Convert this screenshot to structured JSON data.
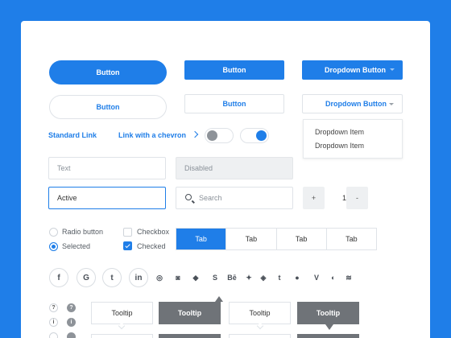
{
  "buttons": {
    "pill_fill": "Button",
    "pill_outline": "Button",
    "rect_fill": "Button",
    "rect_outline": "Button",
    "dropdown_fill": "Dropdown Button",
    "dropdown_outline": "Dropdown Button"
  },
  "dropdown_menu": {
    "items": [
      "Dropdown Item",
      "Dropdown Item"
    ]
  },
  "links": {
    "standard": "Standard Link",
    "chevron": "Link with a chevron"
  },
  "inputs": {
    "text_placeholder": "Text",
    "disabled_placeholder": "Disabled",
    "active_value": "Active",
    "search_placeholder": "Search"
  },
  "stepper": {
    "minus": "-",
    "value": "1",
    "plus": "+"
  },
  "radios": {
    "unselected": "Radio button",
    "selected": "Selected"
  },
  "checkboxes": {
    "unchecked": "Checkbox",
    "checked": "Checked"
  },
  "tabs": [
    "Tab",
    "Tab",
    "Tab",
    "Tab"
  ],
  "social": {
    "circle": [
      "f",
      "G",
      "t",
      "in"
    ],
    "glyph": [
      "◎",
      "◙",
      "◆",
      "S",
      "Bē",
      "✦",
      "◈",
      "t",
      "●",
      "V",
      "◐",
      "≋"
    ],
    "icon_names": [
      "facebook-icon",
      "google-icon",
      "twitter-icon",
      "linkedin-icon",
      "dribbble-icon",
      "instagram-icon",
      "dropbox-icon",
      "skype-icon",
      "behance-icon",
      "yelp-icon",
      "codepen-icon",
      "tumblr-icon",
      "github-icon",
      "vimeo-icon",
      "vine-icon",
      "rss-icon"
    ]
  },
  "tooltips": {
    "light": "Tooltip",
    "dark": "Tooltip"
  },
  "help_icons": {
    "question": "?",
    "info": "i"
  },
  "colors": {
    "accent": "#1f7ee8",
    "dark_tooltip": "#6f7378",
    "toggle_off_knob": "#8e9399"
  }
}
